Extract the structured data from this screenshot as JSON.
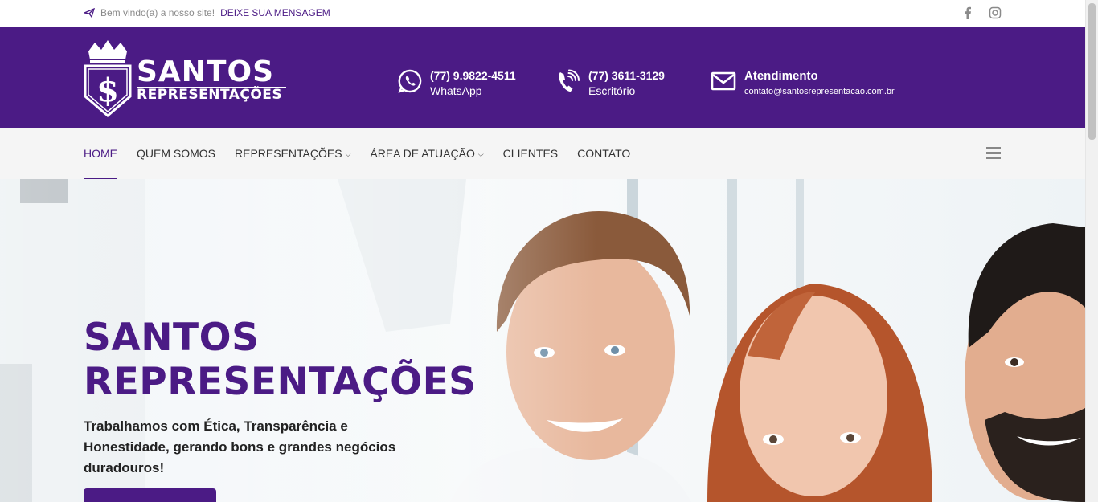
{
  "topbar": {
    "welcome_text": "Bem vindo(a) a nosso site!",
    "message_link": "DEIXE SUA MENSAGEM",
    "social_icons": [
      "facebook-icon",
      "instagram-icon"
    ]
  },
  "header": {
    "logo": {
      "brand": "SANTOS",
      "sub": "REPRESENTAÇÕES"
    },
    "contacts": [
      {
        "icon": "whatsapp-icon",
        "line1": "(77) 9.9822-4511",
        "line2": "WhatsApp"
      },
      {
        "icon": "phone-icon",
        "line1": "(77) 3611-3129",
        "line2": "Escritório"
      },
      {
        "icon": "envelope-icon",
        "line1": "Atendimento",
        "line2": "contato@santosrepresentacao.com.br"
      }
    ]
  },
  "nav": {
    "items": [
      {
        "label": "HOME",
        "active": true
      },
      {
        "label": "QUEM SOMOS"
      },
      {
        "label": "REPRESENTAÇÕES",
        "dropdown": true
      },
      {
        "label": "ÁREA DE ATUAÇÃO",
        "dropdown": true
      },
      {
        "label": "CLIENTES"
      },
      {
        "label": "CONTATO"
      }
    ]
  },
  "hero": {
    "title_line1": "SANTOS",
    "title_line2": "REPRESENTAÇÕES",
    "lead": "Trabalhamos com Ética, Transparência e Honestidade, gerando bons e grandes negócios duradouros!"
  },
  "colors": {
    "brand": "#4b1b85",
    "nav_bg": "#f5f5f5",
    "white": "#ffffff"
  }
}
